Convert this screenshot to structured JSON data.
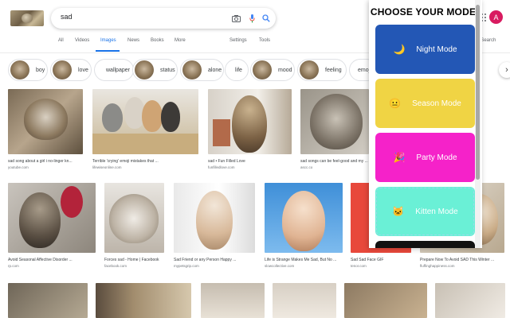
{
  "search": {
    "query": "sad"
  },
  "header": {
    "avatar_letter": "A"
  },
  "tabs": [
    {
      "label": "All"
    },
    {
      "label": "Videos"
    },
    {
      "label": "Images"
    },
    {
      "label": "News"
    },
    {
      "label": "Books"
    },
    {
      "label": "More"
    },
    {
      "label": "Settings"
    },
    {
      "label": "Tools"
    }
  ],
  "safesearch_label": "eSearch",
  "chips": [
    {
      "label": "boy"
    },
    {
      "label": "love"
    },
    {
      "label": "wallpaper"
    },
    {
      "label": "status"
    },
    {
      "label": "alone"
    },
    {
      "label": "life"
    },
    {
      "label": "mood"
    },
    {
      "label": "feeling"
    },
    {
      "label": "emoji"
    }
  ],
  "results_row1": [
    {
      "caption": "sad song about a girl i no-linger kn...",
      "source": "youtube.com"
    },
    {
      "caption": "Terrible 'crying' emoji mistakes that ...",
      "source": "lifewiseonline.com"
    },
    {
      "caption": "sad • Fun Filled Love",
      "source": "funfilledlove.com"
    },
    {
      "caption": "sad songs can be feel-good and my ...",
      "source": "ascc.co"
    }
  ],
  "results_row2": [
    {
      "caption": "Avoid Seasonal Affective Disorder ...",
      "source": "rp.com"
    },
    {
      "caption": "Forces sad - Home | Facebook",
      "source": "facebook.com"
    },
    {
      "caption": "Sad Friend or any Person Happy ...",
      "source": "mypetsgrip.com"
    },
    {
      "caption": "Life is Strange Makes Me Sad, But No ...",
      "source": "slowcollective.com"
    },
    {
      "caption": "Sad Sad Face GIF",
      "source": "tenor.com"
    },
    {
      "caption": "Prepare Now To Avoid SAD This Winter ...",
      "source": "fluffinghappiness.com"
    }
  ],
  "popup": {
    "title": "CHOOSE YOUR MODE",
    "modes": [
      {
        "emoji": "🌙",
        "label": "Night Mode",
        "color": "#2357b5"
      },
      {
        "emoji": "😐",
        "label": "Season Mode",
        "color": "#f0d444"
      },
      {
        "emoji": "🎉",
        "label": "Party Mode",
        "color": "#f522c9"
      },
      {
        "emoji": "🐱",
        "label": "Kitten Mode",
        "color": "#6af0d6"
      }
    ]
  },
  "colors": {
    "accent": "#1a73e8",
    "avatar": "#d81b60",
    "night": "#2357b5",
    "season": "#f0d444",
    "party": "#f522c9",
    "kitten": "#6af0d6"
  }
}
